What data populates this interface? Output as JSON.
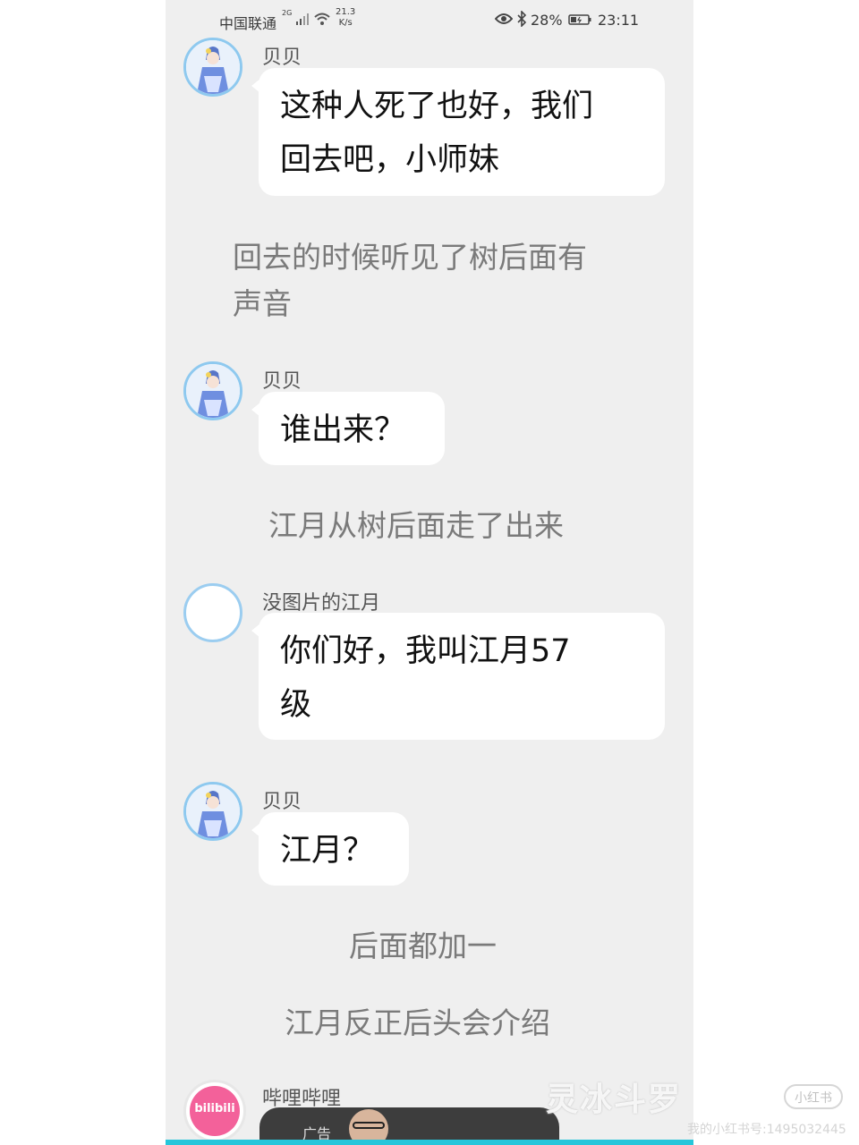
{
  "status_bar": {
    "carrier": "中国联通",
    "network": "2G",
    "speed_value": "21.3",
    "speed_unit": "K/s",
    "battery": "28%",
    "time": "23:11"
  },
  "messages": [
    {
      "type": "bubble",
      "sender": "贝贝",
      "avatar": "anime-avatar",
      "text_lines": [
        "这种人死了也好，我们",
        "回去吧，小师妹"
      ]
    },
    {
      "type": "narration",
      "text_lines": [
        "回去的时候听见了树后面有",
        "声音"
      ]
    },
    {
      "type": "bubble",
      "sender": "贝贝",
      "avatar": "anime-avatar",
      "text_lines": [
        "谁出来？"
      ]
    },
    {
      "type": "narration",
      "text_lines": [
        "江月从树后面走了出来"
      ]
    },
    {
      "type": "bubble",
      "sender": "没图片的江月",
      "avatar": "empty-avatar",
      "text_lines": [
        "你们好，我叫江月57",
        "级"
      ]
    },
    {
      "type": "bubble",
      "sender": "贝贝",
      "avatar": "anime-avatar",
      "text_lines": [
        "江月？"
      ]
    },
    {
      "type": "narration",
      "text_lines": [
        "后面都加一"
      ]
    },
    {
      "type": "narration",
      "text_lines": [
        "江月反正后头会介绍"
      ]
    },
    {
      "type": "bubble",
      "sender": "哔哩哔哩",
      "avatar": "bilibili-avatar",
      "text_lines": []
    }
  ],
  "bilibili": {
    "logo_text": "bilibili",
    "ad_label": "广告"
  },
  "watermark": {
    "title": "灵冰斗罗",
    "badge": "小红书",
    "id_text": "我的小红书号:1495032445"
  }
}
